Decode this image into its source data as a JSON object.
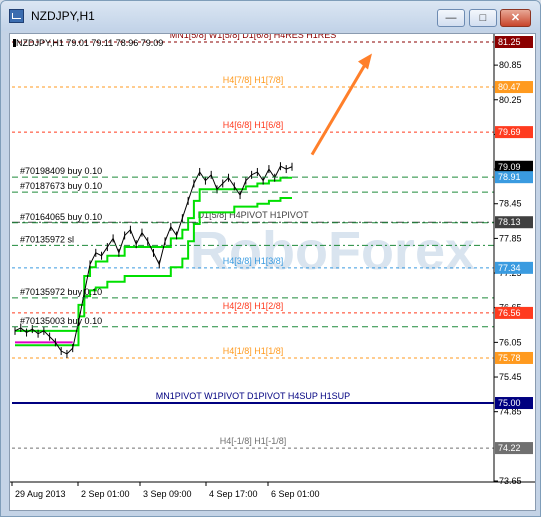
{
  "window": {
    "title": "NZDJPY,H1",
    "buttons": {
      "minimize": "—",
      "maximize": "□",
      "close": "✕"
    }
  },
  "chart_info": {
    "symbol_line": "NZDJPY,H1  79.01 79.11 78.96 79.09"
  },
  "watermark": "RoboForex",
  "colors": {
    "res_red": "#ff3b1f",
    "orange": "#ff9a1f",
    "blue": "#3a9be0",
    "green": "#1e8a3a",
    "navy": "#000080",
    "gray": "#707070",
    "magenta": "#e000c8",
    "lime": "#00e000"
  },
  "chart_data": {
    "type": "line",
    "symbol": "NZDJPY",
    "timeframe": "H1",
    "ohlc_last": {
      "open": 79.01,
      "high": 79.11,
      "low": 78.96,
      "close": 79.09
    },
    "ylim": [
      73.5,
      81.3
    ],
    "y_ticks": [
      80.85,
      80.25,
      79.65,
      79.05,
      78.45,
      77.85,
      77.25,
      76.65,
      76.05,
      75.45,
      74.85,
      73.65
    ],
    "x_ticks": [
      "29 Aug 2013",
      "2 Sep 01:00",
      "3 Sep 09:00",
      "4 Sep 17:00",
      "6 Sep 01:00"
    ],
    "levels": [
      {
        "label": "MN1[5/8] W1[5/8] D1[6/8] H4RES H1RES",
        "value": 81.25,
        "value_label": "81.25",
        "color": "#8b0000",
        "style": "dash"
      },
      {
        "label": "H4[7/8] H1[7/8]",
        "value": 80.47,
        "value_label": "80.47",
        "color": "#ff9a1f",
        "style": "dash"
      },
      {
        "label": "H4[6/8] H1[6/8]",
        "value": 79.69,
        "value_label": "79.69",
        "color": "#ff3b1f",
        "style": "dash"
      },
      {
        "label": "D1[5/8] H4PIVOT H1PIVOT",
        "value": 78.13,
        "value_label": "78.13",
        "color": "#404040",
        "style": "dashdot"
      },
      {
        "label": "H4[3/8] H1[3/8]",
        "value": 77.34,
        "value_label": "77.34",
        "color": "#3a9be0",
        "style": "dash"
      },
      {
        "label": "H4[2/8] H1[2/8]",
        "value": 76.56,
        "value_label": "76.56",
        "color": "#ff3b1f",
        "style": "dash"
      },
      {
        "label": "H4[1/8] H1[1/8]",
        "value": 75.78,
        "value_label": "75.78",
        "color": "#ff9a1f",
        "style": "dash"
      },
      {
        "label": "MN1PIVOT W1PIVOT D1PIVOT H4SUP H1SUP",
        "value": 75.0,
        "value_label": "75.00",
        "color": "#000080",
        "style": "solid"
      },
      {
        "label": "H4[-1/8] H1[-1/8]",
        "value": 74.22,
        "value_label": "74.22",
        "color": "#707070",
        "style": "dash"
      }
    ],
    "current_price": {
      "value": 79.09,
      "label": "79.09"
    },
    "current_ask": {
      "value": 78.91,
      "label": "78.91"
    },
    "orders": [
      {
        "label": "#70198409 buy 0.10",
        "value": 78.91
      },
      {
        "label": "#70187673 buy 0.10",
        "value": 78.65
      },
      {
        "label": "#70164065 buy 0.10",
        "value": 78.12
      },
      {
        "label": "#70135972 sl",
        "value": 77.73
      },
      {
        "label": "#70135972 buy 0.10",
        "value": 76.82
      },
      {
        "label": "#70135003 buy 0.10",
        "value": 76.32
      }
    ],
    "price_series": [
      76.25,
      76.3,
      76.22,
      76.28,
      76.2,
      76.25,
      76.15,
      76.05,
      75.9,
      75.85,
      75.95,
      76.4,
      76.9,
      77.4,
      77.6,
      77.55,
      77.7,
      77.85,
      77.6,
      77.9,
      78.0,
      77.75,
      77.95,
      77.8,
      77.6,
      77.4,
      77.8,
      78.05,
      77.9,
      78.2,
      78.5,
      78.8,
      79.0,
      78.85,
      78.95,
      78.7,
      78.8,
      78.9,
      78.75,
      78.6,
      78.85,
      78.95,
      79.0,
      78.85,
      79.05,
      78.9,
      79.1,
      79.05,
      79.09
    ],
    "trail_upper": [
      76.25,
      76.25,
      76.25,
      76.25,
      76.25,
      76.25,
      76.25,
      76.25,
      76.25,
      76.25,
      76.25,
      76.7,
      77.2,
      77.35,
      77.45,
      77.45,
      77.55,
      77.55,
      77.55,
      77.7,
      77.7,
      77.7,
      77.7,
      77.7,
      77.7,
      77.7,
      77.7,
      77.85,
      77.85,
      78.0,
      78.2,
      78.5,
      78.7,
      78.7,
      78.7,
      78.7,
      78.7,
      78.7,
      78.7,
      78.7,
      78.75,
      78.75,
      78.8,
      78.8,
      78.85,
      78.85,
      78.9,
      78.9,
      78.9
    ],
    "trail_lower": [
      76.0,
      76.0,
      76.0,
      76.0,
      76.0,
      76.0,
      76.0,
      76.0,
      76.0,
      76.0,
      76.0,
      76.5,
      76.85,
      76.95,
      77.0,
      77.0,
      77.1,
      77.1,
      77.1,
      77.2,
      77.2,
      77.2,
      77.2,
      77.2,
      77.2,
      77.2,
      77.2,
      77.35,
      77.35,
      77.5,
      77.8,
      78.1,
      78.3,
      78.3,
      78.3,
      78.3,
      78.3,
      78.3,
      78.4,
      78.4,
      78.4,
      78.4,
      78.45,
      78.45,
      78.5,
      78.5,
      78.55,
      78.55,
      78.55
    ],
    "magenta_segment": [
      76.05,
      76.05,
      76.05,
      76.05,
      76.05,
      76.05,
      76.05,
      76.05,
      76.05,
      76.05,
      76.05
    ],
    "arrow": {
      "from_value": 79.3,
      "to_value": 81.05,
      "color": "#ff7f2a"
    }
  }
}
